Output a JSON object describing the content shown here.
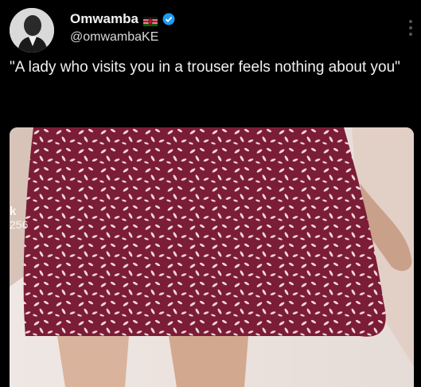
{
  "tweet": {
    "display_name": "Omwamba",
    "handle": "@omwambaKE",
    "text": "\"A lady who visits you in a trouser feels nothing about you\"",
    "media_watermark": {
      "letter": "k",
      "number": "256"
    }
  },
  "icons": {
    "flag": "kenya-flag-icon",
    "verified": "verified-badge-icon",
    "more": "more-options-icon"
  },
  "colors": {
    "background": "#000000",
    "text": "#e7e9ea",
    "verified": "#1d9bf0",
    "dress": "#7b1d36",
    "pattern": "#f2d7d9"
  }
}
